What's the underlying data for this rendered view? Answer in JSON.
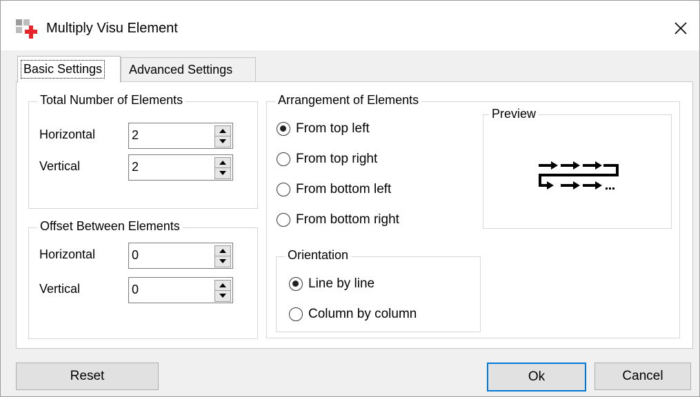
{
  "window": {
    "title": "Multiply Visu Element"
  },
  "tabs": [
    {
      "label": "Basic Settings",
      "selected": true
    },
    {
      "label": "Advanced Settings",
      "selected": false
    }
  ],
  "total": {
    "title": "Total Number of Elements",
    "horizontal_label": "Horizontal",
    "horizontal_value": "2",
    "vertical_label": "Vertical",
    "vertical_value": "2"
  },
  "offset": {
    "title": "Offset Between Elements",
    "horizontal_label": "Horizontal",
    "horizontal_value": "0",
    "vertical_label": "Vertical",
    "vertical_value": "0"
  },
  "arrangement": {
    "title": "Arrangement of Elements",
    "options": [
      {
        "label": "From top left",
        "checked": true
      },
      {
        "label": "From top right",
        "checked": false
      },
      {
        "label": "From bottom left",
        "checked": false
      },
      {
        "label": "From bottom right",
        "checked": false
      }
    ]
  },
  "orientation": {
    "title": "Orientation",
    "options": [
      {
        "label": "Line by line",
        "checked": true
      },
      {
        "label": "Column by column",
        "checked": false
      }
    ]
  },
  "preview": {
    "title": "Preview",
    "icon": "arrow-path-preview-icon"
  },
  "buttons": {
    "reset": "Reset",
    "ok": "Ok",
    "cancel": "Cancel"
  },
  "colors": {
    "app_icon_red": "#e8242b",
    "app_icon_gray": "#9c9c9c",
    "default_button_border": "#0078d7"
  }
}
